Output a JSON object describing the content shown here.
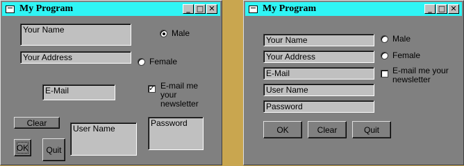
{
  "left_window": {
    "title": "My Program",
    "fields": {
      "name": "Your Name",
      "address": "Your Address",
      "email": "E-Mail",
      "username": "User Name",
      "password": "Password"
    },
    "radios": {
      "male": "Male",
      "female": "Female",
      "selected": "male"
    },
    "newsletter": {
      "label": "E-mail me your newsletter",
      "checked": true
    },
    "buttons": {
      "clear": "Clear",
      "ok": "OK",
      "quit": "Quit"
    }
  },
  "right_window": {
    "title": "My Program",
    "fields": {
      "name": "Your Name",
      "address": "Your Address",
      "email": "E-Mail",
      "username": "User Name",
      "password": "Password"
    },
    "radios": {
      "male": "Male",
      "female": "Female",
      "selected": "none"
    },
    "newsletter": {
      "label": "E-mail me your newsletter",
      "checked": false
    },
    "buttons": {
      "ok": "OK",
      "clear": "Clear",
      "quit": "Quit"
    }
  },
  "titlebar_buttons": {
    "minimize": "_",
    "maximize": "□",
    "close": "✕"
  },
  "colors": {
    "titlebar": "#2ff5f5",
    "window_bg": "#808080",
    "desktop": "#c9a64f"
  }
}
